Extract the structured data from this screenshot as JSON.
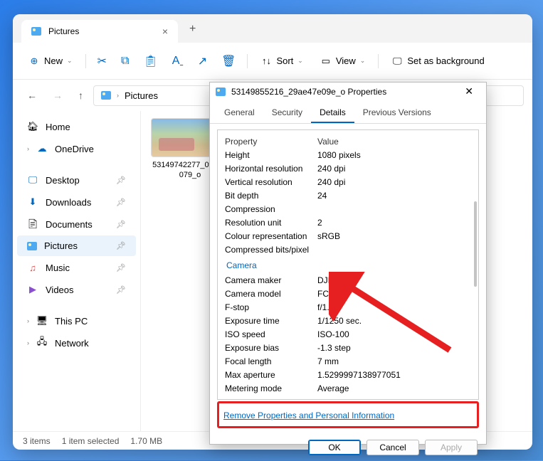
{
  "tab": {
    "title": "Pictures"
  },
  "toolbar": {
    "new": "New",
    "sort": "Sort",
    "view": "View",
    "setbg": "Set as background"
  },
  "breadcrumb": {
    "location": "Pictures"
  },
  "sidebar": {
    "home": "Home",
    "onedrive": "OneDrive",
    "desktop": "Desktop",
    "downloads": "Downloads",
    "documents": "Documents",
    "pictures": "Pictures",
    "music": "Music",
    "videos": "Videos",
    "thispc": "This PC",
    "network": "Network"
  },
  "file": {
    "thumb_label": "53149742277_0f1cec079_o"
  },
  "status": {
    "items": "3 items",
    "selected": "1 item selected",
    "size": "1.70 MB"
  },
  "dialog": {
    "title": "53149855216_29ae47e09e_o Properties",
    "tabs": {
      "general": "General",
      "security": "Security",
      "details": "Details",
      "previous": "Previous Versions"
    },
    "header": {
      "property": "Property",
      "value": "Value"
    },
    "rows": {
      "height_k": "Height",
      "height_v": "1080 pixels",
      "hres_k": "Horizontal resolution",
      "hres_v": "240 dpi",
      "vres_k": "Vertical resolution",
      "vres_v": "240 dpi",
      "bitd_k": "Bit depth",
      "bitd_v": "24",
      "comp_k": "Compression",
      "comp_v": "",
      "resu_k": "Resolution unit",
      "resu_v": "2",
      "crep_k": "Colour representation",
      "crep_v": "sRGB",
      "cbpp_k": "Compressed bits/pixel",
      "cbpp_v": "",
      "section_camera": "Camera",
      "cmkr_k": "Camera maker",
      "cmkr_v": "DJI",
      "cmdl_k": "Camera model",
      "cmdl_v": "FC3582",
      "fstp_k": "F-stop",
      "fstp_v": "f/1.7",
      "expt_k": "Exposure time",
      "expt_v": "1/1250 sec.",
      "iso_k": "ISO speed",
      "iso_v": "ISO-100",
      "expb_k": "Exposure bias",
      "expb_v": "-1.3 step",
      "flen_k": "Focal length",
      "flen_v": "7 mm",
      "maxa_k": "Max aperture",
      "maxa_v": "1.5299997138977051",
      "mmde_k": "Metering mode",
      "mmde_v": "Average"
    },
    "remove_link": "Remove Properties and Personal Information",
    "buttons": {
      "ok": "OK",
      "cancel": "Cancel",
      "apply": "Apply"
    }
  }
}
